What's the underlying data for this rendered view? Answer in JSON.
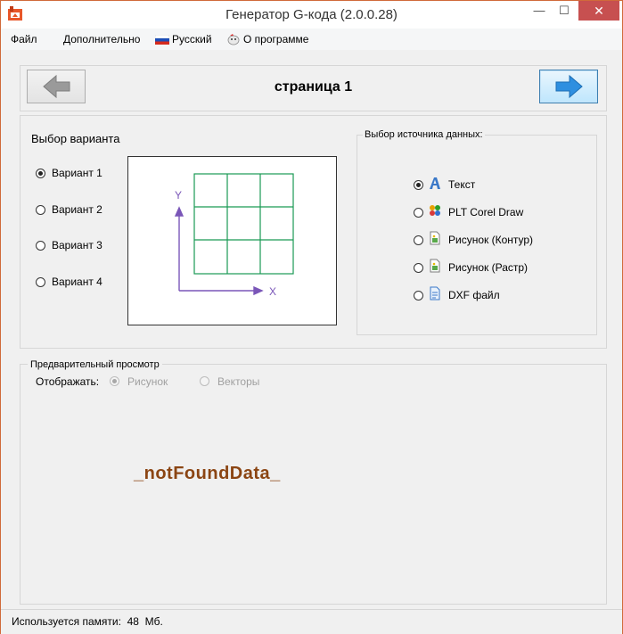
{
  "window": {
    "title": "Генератор G-кода (2.0.0.28)",
    "controls": {
      "minimize": "—",
      "maximize": "☐",
      "close": "✕"
    }
  },
  "menu": {
    "file": "Файл",
    "extra": "Дополнительно",
    "language": "Русский",
    "about": "О программе"
  },
  "nav": {
    "page_title": "страница 1"
  },
  "variant": {
    "title": "Выбор варианта",
    "options": [
      "Вариант 1",
      "Вариант 2",
      "Вариант 3",
      "Вариант 4"
    ],
    "selected_index": 0,
    "axis_y": "Y",
    "axis_x": "X"
  },
  "source": {
    "legend": "Выбор источника данных:",
    "options": [
      "Текст",
      "PLT Corel Draw",
      "Рисунок (Контур)",
      "Рисунок (Растр)",
      "DXF файл"
    ],
    "selected_index": 0
  },
  "preview": {
    "legend": "Предварительный просмотр",
    "display_label": "Отображать:",
    "opt_picture": "Рисунок",
    "opt_vectors": "Векторы",
    "message": "_notFoundData_"
  },
  "status": {
    "memory_label": "Используется памяти:",
    "memory_value": "48",
    "memory_unit": "Мб."
  },
  "colors": {
    "grid": "#1a9a55",
    "axis": "#7a56b8",
    "accent_arrow": "#2e8fe0",
    "message": "#8b4513"
  }
}
